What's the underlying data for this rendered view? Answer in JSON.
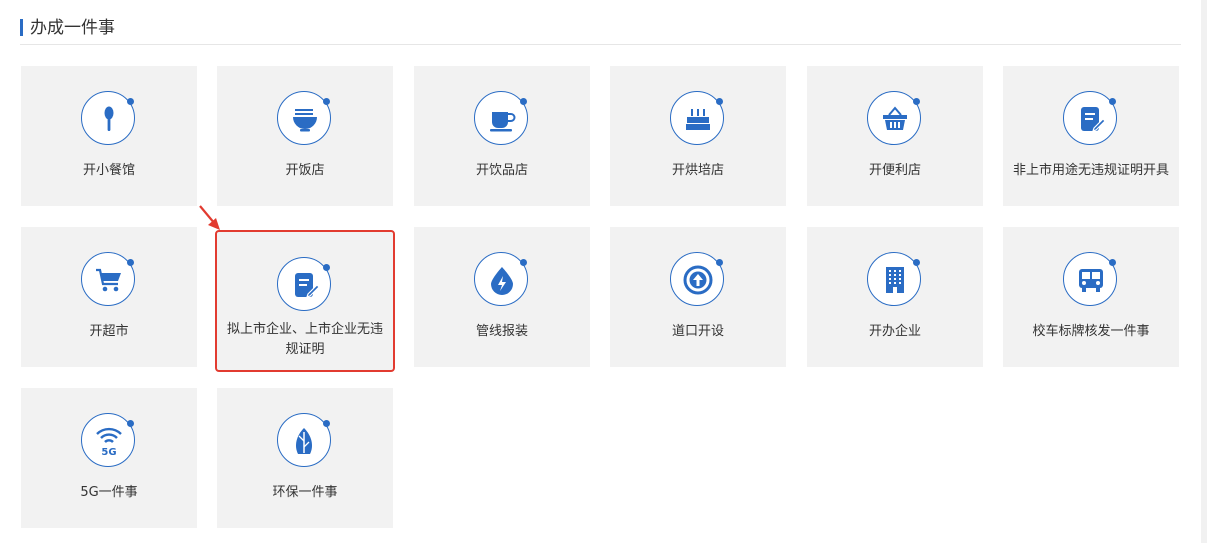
{
  "section": {
    "title": "办成一件事"
  },
  "cards": [
    {
      "label": "开小餐馆",
      "icon": "spoon-icon"
    },
    {
      "label": "开饭店",
      "icon": "noodle-bowl-icon"
    },
    {
      "label": "开饮品店",
      "icon": "coffee-cup-icon"
    },
    {
      "label": "开烘培店",
      "icon": "cake-icon"
    },
    {
      "label": "开便利店",
      "icon": "shopping-basket-icon"
    },
    {
      "label": "非上市用途无违规证明开具",
      "icon": "document-edit-icon"
    },
    {
      "label": "开超市",
      "icon": "shopping-cart-icon"
    },
    {
      "label": "拟上市企业、上市企业无违规证明",
      "icon": "document-edit-icon"
    },
    {
      "label": "管线报装",
      "icon": "power-drop-icon"
    },
    {
      "label": "道口开设",
      "icon": "arrow-up-circle-icon"
    },
    {
      "label": "开办企业",
      "icon": "building-icon"
    },
    {
      "label": "校车标牌核发一件事",
      "icon": "bus-icon"
    },
    {
      "label": "5G一件事",
      "icon": "5g-signal-icon"
    },
    {
      "label": "环保一件事",
      "icon": "leaf-icon"
    }
  ],
  "colors": {
    "accent": "#2a6cc4",
    "card_bg": "#f2f2f2",
    "highlight": "#e23b30"
  }
}
